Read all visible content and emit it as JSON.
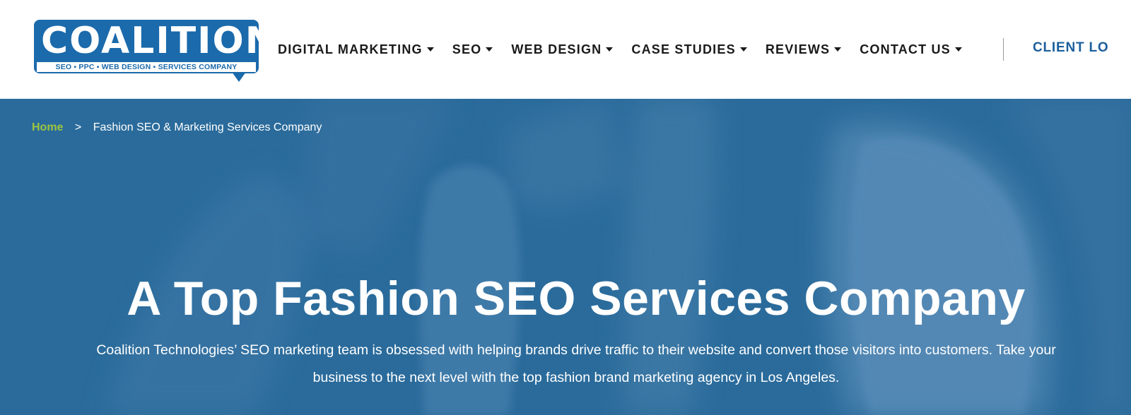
{
  "logo": {
    "word": "COALITION",
    "tagline": "SEO ▪ PPC ▪ WEB DESIGN ▪ SERVICES COMPANY"
  },
  "nav": {
    "items": [
      {
        "label": "DIGITAL MARKETING"
      },
      {
        "label": "SEO"
      },
      {
        "label": "WEB DESIGN"
      },
      {
        "label": "CASE STUDIES"
      },
      {
        "label": "REVIEWS"
      },
      {
        "label": "CONTACT US"
      }
    ],
    "client_login": "CLIENT LO"
  },
  "breadcrumb": {
    "home": "Home",
    "separator": ">",
    "current": "Fashion SEO & Marketing Services Company"
  },
  "hero": {
    "title": "A Top Fashion SEO Services Company",
    "text": "Coalition Technologies’ SEO marketing team is obsessed with helping brands drive traffic to their website and convert those visitors into customers. Take your business to the next level with the top fashion brand marketing agency in Los Angeles."
  },
  "colors": {
    "brand_blue": "#1b6aab",
    "hero_blue": "#2e6f9e",
    "breadcrumb_green": "#9dc43f",
    "nav_text": "#1a1a1a"
  }
}
